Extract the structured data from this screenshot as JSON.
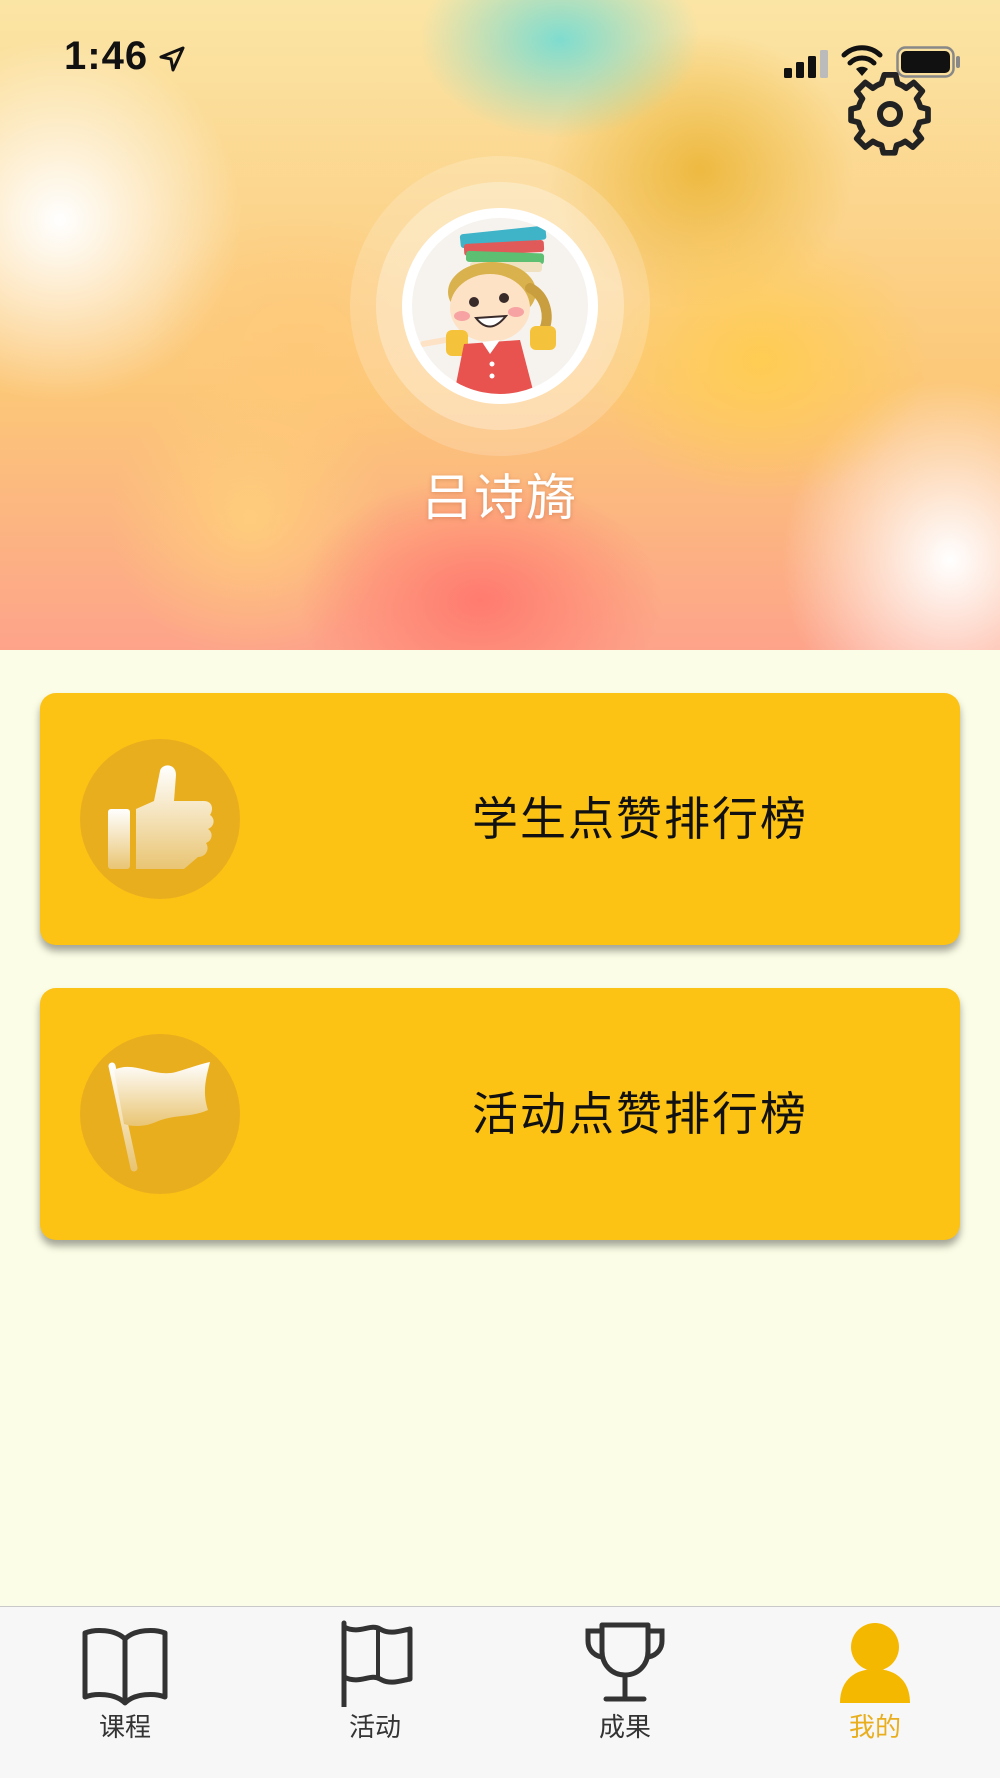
{
  "status_bar": {
    "time": "1:46"
  },
  "profile": {
    "name": "吕诗旖"
  },
  "rankings": [
    {
      "label": "学生点赞排行榜",
      "icon": "thumbs-up-icon"
    },
    {
      "label": "活动点赞排行榜",
      "icon": "flag-icon"
    }
  ],
  "tab_bar": {
    "items": [
      {
        "label": "课程",
        "icon": "book-icon",
        "active": false
      },
      {
        "label": "活动",
        "icon": "flag-icon",
        "active": false
      },
      {
        "label": "成果",
        "icon": "trophy-icon",
        "active": false
      },
      {
        "label": "我的",
        "icon": "person-icon",
        "active": true
      }
    ]
  },
  "colors": {
    "accent": "#fcc214",
    "icon_circle": "#e9ae1e",
    "page_background": "#fbfde6",
    "active_tab": "#e9ae1e",
    "tab_bar_background": "#f7f7f7"
  }
}
